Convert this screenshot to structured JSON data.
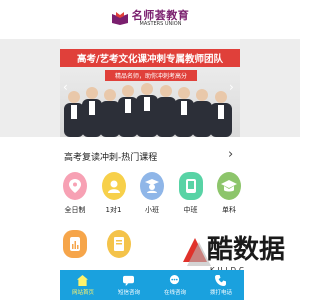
{
  "header": {
    "logo_cn": "名师荟教育",
    "logo_en": "MASTERS UNION",
    "brand_color": "#7a1f6e"
  },
  "banner": {
    "title": "高考/艺考文化课冲刺专属教师团队",
    "subtitle": "精品名师，助你冲刺考高分",
    "accent": "#e0403a"
  },
  "section": {
    "title": "高考复读冲刺-热门课程",
    "more_icon": "chevron-right-icon"
  },
  "courses_row1": [
    {
      "label": "全日制",
      "icon": "location-pin-icon",
      "color": "#f7a1b4"
    },
    {
      "label": "1对1",
      "icon": "student-icon",
      "color": "#f7d04a"
    },
    {
      "label": "小班",
      "icon": "graduate-icon",
      "color": "#8fb6e8"
    },
    {
      "label": "中班",
      "icon": "tablet-icon",
      "color": "#58d3a5"
    },
    {
      "label": "单科",
      "icon": "graduation-cap-icon",
      "color": "#8dc56b"
    }
  ],
  "courses_row2": [
    {
      "icon": "chart-icon",
      "color": "#f6a54a"
    },
    {
      "icon": "document-icon",
      "color": "#f4c34a"
    }
  ],
  "tabbar": {
    "bg": "#1aa1de",
    "items": [
      {
        "label": "网站首页",
        "icon": "home-icon",
        "active": true
      },
      {
        "label": "短信咨询",
        "icon": "sms-icon",
        "active": false
      },
      {
        "label": "在线咨询",
        "icon": "chat-icon",
        "active": false
      },
      {
        "label": "拨打电话",
        "icon": "phone-icon",
        "active": false
      }
    ]
  },
  "watermark": {
    "text": "酷数据",
    "sub": "KUIDC"
  }
}
